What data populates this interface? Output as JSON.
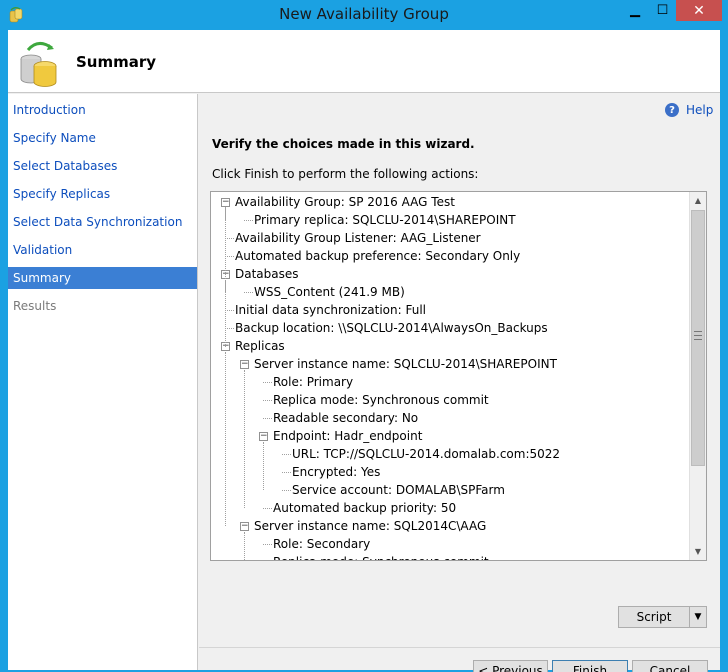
{
  "window": {
    "title": "New Availability Group"
  },
  "window_controls": {
    "minimize": "▁",
    "maximize": "☐",
    "close": "✕"
  },
  "header": {
    "title": "Summary",
    "icon": "database-sync-icon"
  },
  "sidebar": {
    "items": [
      {
        "label": "Introduction",
        "state": "link"
      },
      {
        "label": "Specify Name",
        "state": "link"
      },
      {
        "label": "Select Databases",
        "state": "link"
      },
      {
        "label": "Specify Replicas",
        "state": "link"
      },
      {
        "label": "Select Data Synchronization",
        "state": "link"
      },
      {
        "label": "Validation",
        "state": "link"
      },
      {
        "label": "Summary",
        "state": "active"
      },
      {
        "label": "Results",
        "state": "disabled"
      }
    ]
  },
  "help": {
    "label": "Help",
    "icon": "help-icon"
  },
  "content": {
    "verify": "Verify the choices made in this wizard.",
    "instruction": "Click Finish to perform the following actions:"
  },
  "tree": {
    "rows": [
      {
        "text": "Availability Group: SP 2016 AAG Test",
        "level": 0,
        "toggle": "−"
      },
      {
        "text": "Primary replica: SQLCLU-2014\\SHAREPOINT",
        "level": 1,
        "toggle": null
      },
      {
        "text": "Availability Group Listener: AAG_Listener",
        "level": 0,
        "toggle": null
      },
      {
        "text": "Automated backup preference: Secondary Only",
        "level": 0,
        "toggle": null
      },
      {
        "text": "Databases",
        "level": 0,
        "toggle": "−"
      },
      {
        "text": "WSS_Content (241.9 MB)",
        "level": 1,
        "toggle": null
      },
      {
        "text": "Initial data synchronization: Full",
        "level": 0,
        "toggle": null
      },
      {
        "text": "Backup location: \\\\SQLCLU-2014\\AlwaysOn_Backups",
        "level": 0,
        "toggle": null
      },
      {
        "text": "Replicas",
        "level": 0,
        "toggle": "−"
      },
      {
        "text": "Server instance name: SQLCLU-2014\\SHAREPOINT",
        "level": 1,
        "toggle": "−"
      },
      {
        "text": "Role: Primary",
        "level": 2,
        "toggle": null
      },
      {
        "text": "Replica mode: Synchronous commit",
        "level": 2,
        "toggle": null
      },
      {
        "text": "Readable secondary: No",
        "level": 2,
        "toggle": null
      },
      {
        "text": "Endpoint: Hadr_endpoint",
        "level": 2,
        "toggle": "−"
      },
      {
        "text": "URL: TCP://SQLCLU-2014.domalab.com:5022",
        "level": 3,
        "toggle": null
      },
      {
        "text": "Encrypted: Yes",
        "level": 3,
        "toggle": null
      },
      {
        "text": "Service account: DOMALAB\\SPFarm",
        "level": 3,
        "toggle": null
      },
      {
        "text": "Automated backup priority: 50",
        "level": 2,
        "toggle": null
      },
      {
        "text": "Server instance name: SQL2014C\\AAG",
        "level": 1,
        "toggle": "−"
      },
      {
        "text": "Role: Secondary",
        "level": 2,
        "toggle": null
      },
      {
        "text": "Replica mode: Synchronous commit",
        "level": 2,
        "toggle": null
      }
    ]
  },
  "buttons": {
    "script": "Script",
    "script_arrow": "▼",
    "previous": "< Previous",
    "finish": "Finish",
    "cancel": "Cancel"
  },
  "scrollbar": {
    "up": "▲",
    "down": "▼"
  }
}
